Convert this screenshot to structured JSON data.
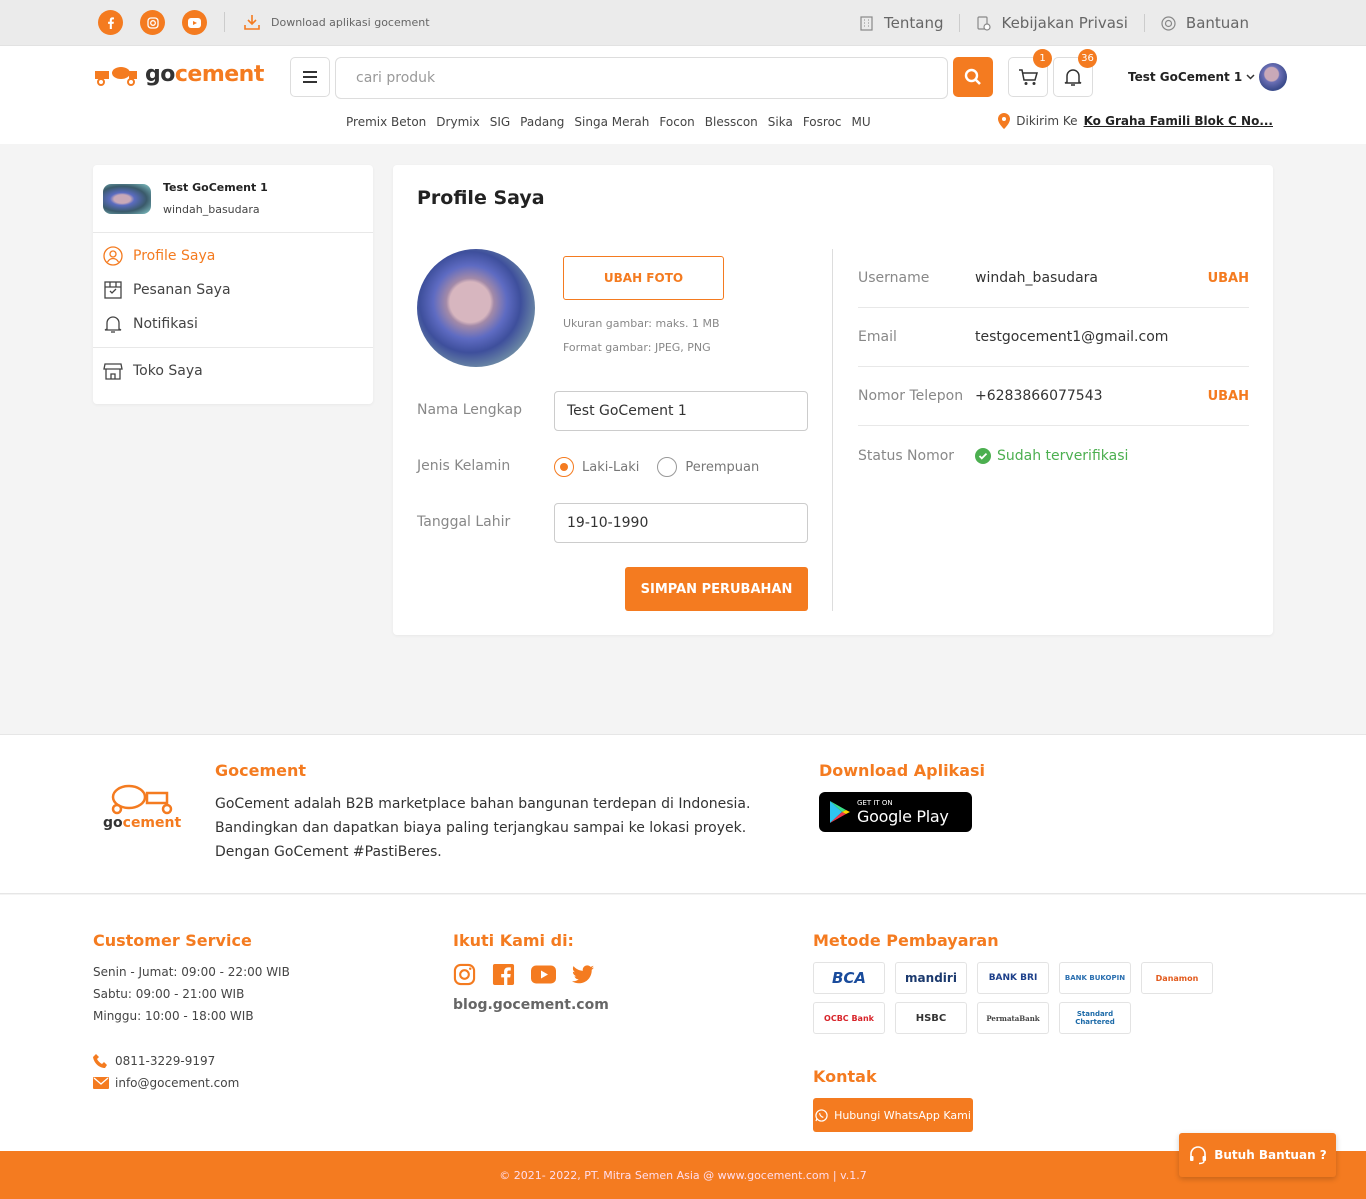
{
  "topbar": {
    "download_text": "Download aplikasi gocement",
    "links": [
      "Tentang",
      "Kebijakan Privasi",
      "Bantuan"
    ]
  },
  "header": {
    "logo": "gocement",
    "search_placeholder": "cari produk",
    "cart_count": "1",
    "notif_count": "36",
    "user_name": "Test GoCement 1",
    "brands": [
      "Premix Beton",
      "Drymix",
      "SIG",
      "Padang",
      "Singa Merah",
      "Focon",
      "Blesscon",
      "Sika",
      "Fosroc",
      "MU"
    ],
    "deliver_prefix": "Dikirim Ke",
    "deliver_address": "Ko Graha Famili Blok C No..."
  },
  "sidebar": {
    "name": "Test GoCement 1",
    "username": "windah_basudara",
    "items": [
      "Profile Saya",
      "Pesanan Saya",
      "Notifikasi",
      "Toko Saya"
    ]
  },
  "profile": {
    "title": "Profile Saya",
    "ubah_foto": "UBAH FOTO",
    "hint_size": "Ukuran gambar: maks. 1 MB",
    "hint_format": "Format gambar: JPEG, PNG",
    "label_name": "Nama Lengkap",
    "value_name": "Test GoCement 1",
    "label_gender": "Jenis Kelamin",
    "gender_male": "Laki-Laki",
    "gender_female": "Perempuan",
    "label_birth": "Tanggal Lahir",
    "value_birth": "19-10-1990",
    "save": "SIMPAN PERUBAHAN"
  },
  "info": {
    "username_label": "Username",
    "username": "windah_basudara",
    "email_label": "Email",
    "email": "testgocement1@gmail.com",
    "phone_label": "Nomor Telepon",
    "phone": "+6283866077543",
    "status_label": "Status Nomor",
    "status": "Sudah terverifikasi",
    "ubah": "UBAH"
  },
  "footer": {
    "brand_title": "Gocement",
    "brand_desc_1": "GoCement adalah B2B marketplace bahan bangunan terdepan di Indonesia.",
    "brand_desc_2": "Bandingkan dan dapatkan biaya paling terjangkau sampai ke lokasi proyek.",
    "brand_desc_3": "Dengan GoCement #PastiBeres.",
    "download_title": "Download Aplikasi",
    "gplay_small": "GET IT ON",
    "gplay_big": "Google Play",
    "cs_title": "Customer Service",
    "cs_hours": [
      "Senin - Jumat: 09:00 - 22:00 WIB",
      "Sabtu: 09:00 - 21:00 WIB",
      "Minggu: 10:00 - 18:00 WIB"
    ],
    "phone": "0811-3229-9197",
    "email": "info@gocement.com",
    "follow_title": "Ikuti Kami di:",
    "blog": "blog.gocement.com",
    "payment_title": "Metode Pembayaran",
    "banks": [
      "BCA",
      "mandiri",
      "BANK BRI",
      "BANK BUKOPIN",
      "Danamon",
      "OCBC Bank",
      "HSBC",
      "PermataBank",
      "Standard Chartered"
    ],
    "contact_title": "Kontak",
    "whatsapp": "Hubungi WhatsApp Kami",
    "copyright": "© 2021- 2022, PT. Mitra Semen Asia @ www.gocement.com | v.1.7",
    "help": "Butuh Bantuan ?"
  },
  "colors": {
    "accent": "#f47b20",
    "verified": "#4caf50"
  }
}
